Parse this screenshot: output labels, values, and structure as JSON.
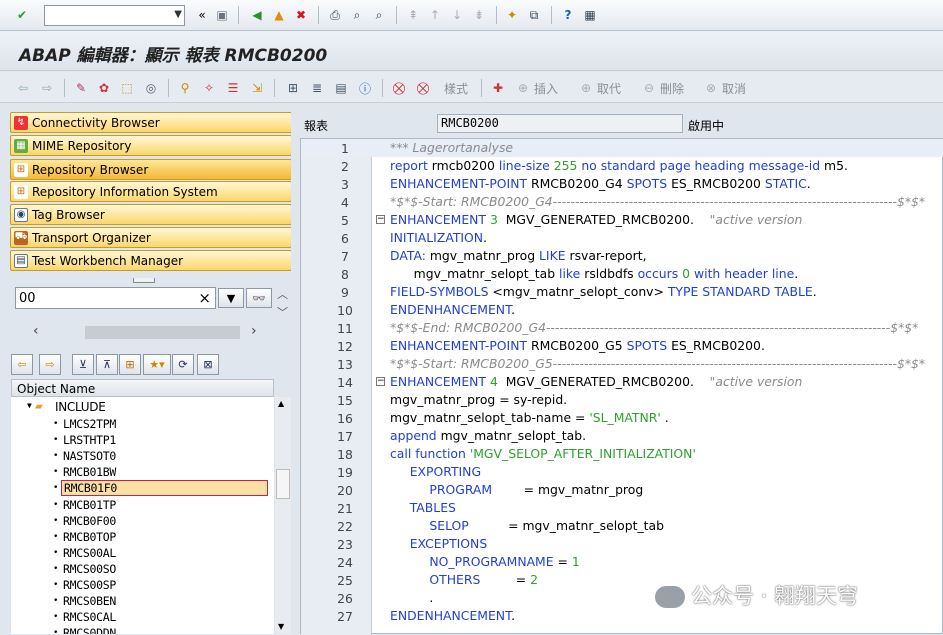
{
  "toolbar": {
    "command_field": ""
  },
  "title": "ABAP 編輯器：顯示 報表 RMCB0200",
  "app_toolbar": {
    "style": "樣式",
    "insert": "插入",
    "replace": "取代",
    "delete": "刪除",
    "cancel": "取消"
  },
  "nav_buttons": [
    "Connectivity Browser",
    "MIME Repository",
    "Repository Browser",
    "Repository Information System",
    "Tag Browser",
    "Transport Organizer",
    "Test Workbench Manager"
  ],
  "object_input": "00",
  "tree": {
    "column_header": "Object Name",
    "folder": "INCLUDE",
    "items": [
      "LMCS2TPM",
      "LRSTHTP1",
      "NASTSOT0",
      "RMCB01BW",
      "RMCB01F0",
      "RMCB01TP",
      "RMCB0F00",
      "RMCB0TOP",
      "RMCS00AL",
      "RMCS00SO",
      "RMCS00SP",
      "RMCS0BEN",
      "RMCS0CAL",
      "RMCS0DDN"
    ],
    "selected": "RMCB01F0"
  },
  "header": {
    "label": "報表",
    "program": "RMCB0200",
    "status": "啟用中"
  },
  "editor": {
    "lines": [
      {
        "n": "1",
        "text": "*** Lagerortanalyse"
      },
      {
        "n": "2",
        "text": "report rmcb0200 line-size 255 no standard page heading message-id m5."
      },
      {
        "n": "3",
        "text": "ENHANCEMENT-POINT RMCB0200_G4 SPOTS ES_RMCB0200 STATIC."
      },
      {
        "n": "4",
        "text": "*$*$-Start: RMCB0200_G4-----------------------------------------------------------------------------$*$*"
      },
      {
        "n": "5",
        "text": "ENHANCEMENT 3  MGV_GENERATED_RMCB0200.    \"active version"
      },
      {
        "n": "6",
        "text": "INITIALIZATION."
      },
      {
        "n": "7",
        "text": "DATA: mgv_matnr_prog LIKE rsvar-report,"
      },
      {
        "n": "8",
        "text": "      mgv_matnr_selopt_tab like rsldbdfs occurs 0 with header line."
      },
      {
        "n": "9",
        "text": "FIELD-SYMBOLS <mgv_matnr_selopt_conv> TYPE STANDARD TABLE."
      },
      {
        "n": "10",
        "text": "ENDENHANCEMENT."
      },
      {
        "n": "11",
        "text": "*$*$-End:   RMCB0200_G4-----------------------------------------------------------------------------$*$*"
      },
      {
        "n": "12",
        "text": "ENHANCEMENT-POINT RMCB0200_G5 SPOTS ES_RMCB0200."
      },
      {
        "n": "13",
        "text": "*$*$-Start: RMCB0200_G5-----------------------------------------------------------------------------$*$*"
      },
      {
        "n": "14",
        "text": "ENHANCEMENT 4  MGV_GENERATED_RMCB0200.    \"active version"
      },
      {
        "n": "15",
        "text": "mgv_matnr_prog = sy-repid."
      },
      {
        "n": "16",
        "text": "mgv_matnr_selopt_tab-name = 'SL_MATNR' ."
      },
      {
        "n": "17",
        "text": "append mgv_matnr_selopt_tab."
      },
      {
        "n": "18",
        "text": "call function 'MGV_SELOP_AFTER_INITIALIZATION'"
      },
      {
        "n": "19",
        "text": "     EXPORTING"
      },
      {
        "n": "20",
        "text": "          PROGRAM        = mgv_matnr_prog"
      },
      {
        "n": "21",
        "text": "     TABLES"
      },
      {
        "n": "22",
        "text": "          SELOP          = mgv_matnr_selopt_tab"
      },
      {
        "n": "23",
        "text": "     EXCEPTIONS"
      },
      {
        "n": "24",
        "text": "          NO_PROGRAMNAME = 1"
      },
      {
        "n": "25",
        "text": "          OTHERS         = 2"
      },
      {
        "n": "26",
        "text": "          ."
      },
      {
        "n": "27",
        "text": "ENDENHANCEMENT."
      }
    ]
  },
  "watermark": "公众号 · 翱翔天穹"
}
